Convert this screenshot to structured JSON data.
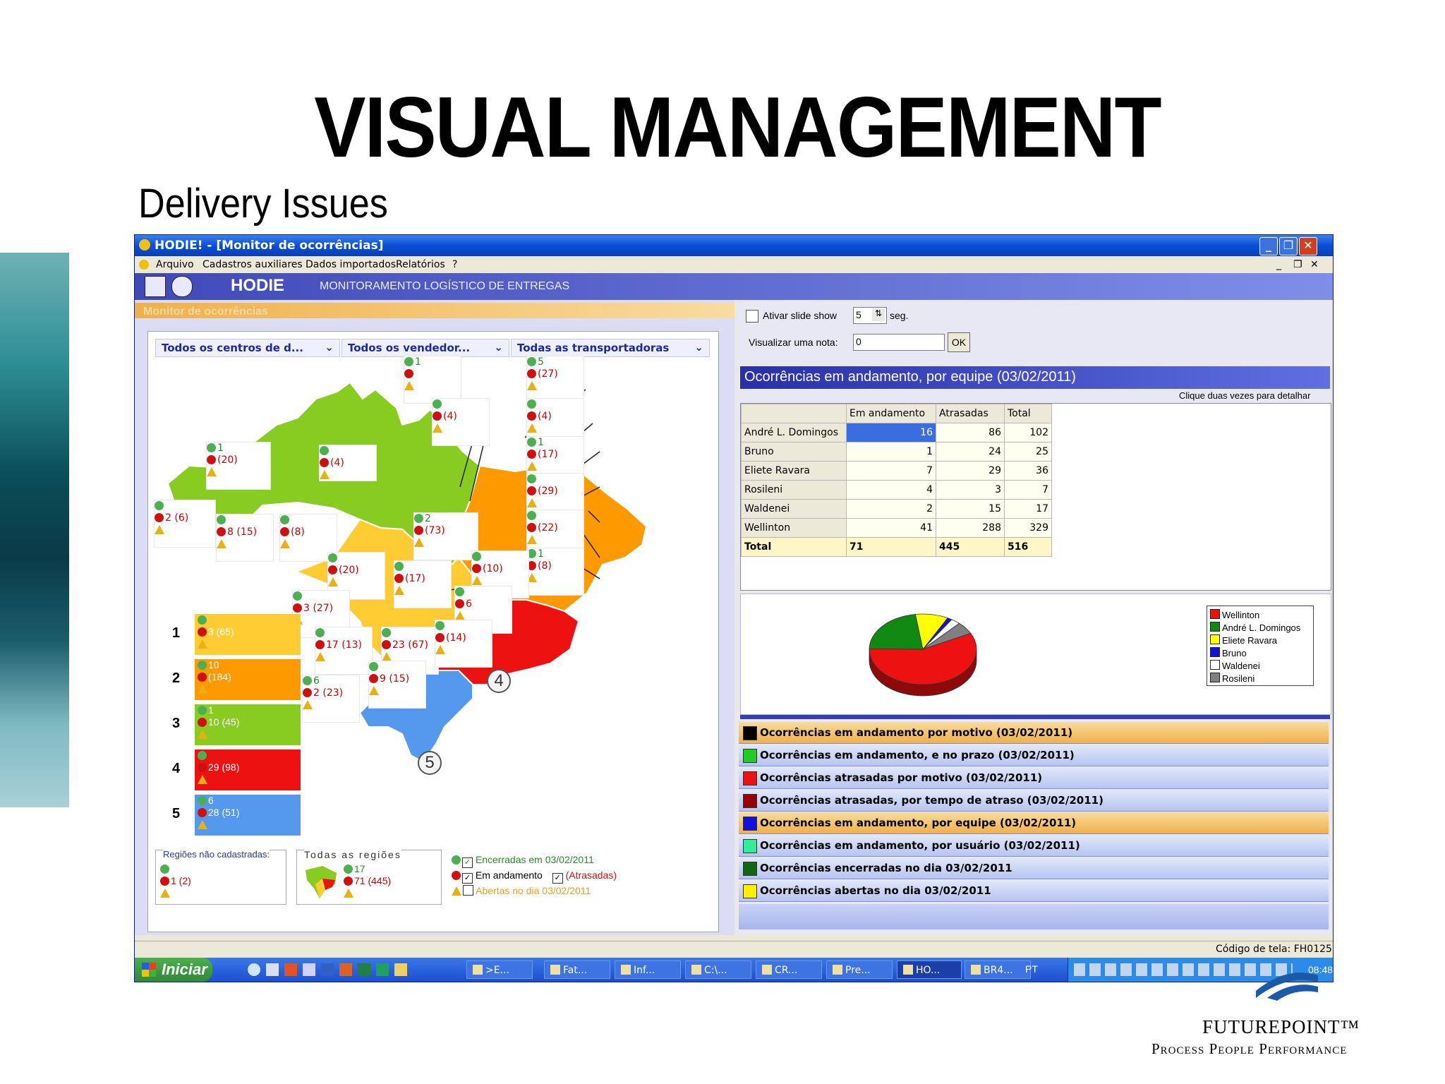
{
  "slide": {
    "title": "VISUAL MANAGEMENT",
    "subtitle": "Delivery Issues",
    "company": "FUTUREPOINT™",
    "tagline": "Process People Performance"
  },
  "window": {
    "title": "HODIE! - [Monitor de ocorrências]",
    "menu": [
      "Arquivo",
      "Cadastros auxiliares",
      "Dados importados",
      "Relatórios",
      "?"
    ],
    "banner_logo": "HODIE",
    "banner_text": "MONITORAMENTO LOGÍSTICO DE ENTREGAS",
    "panel_label": "Monitor de ocorrências"
  },
  "filters": {
    "centers": "Todos os centros de d...",
    "sellers": "Todos os vendedor...",
    "carriers": "Todas as transportadoras"
  },
  "map_boxes": [
    {
      "g": "1",
      "r": "(20)",
      "y": ""
    },
    {
      "g": "",
      "r": "(4)",
      "y": ""
    },
    {
      "g": "",
      "r": "2 (6)",
      "y": ""
    },
    {
      "g": "",
      "r": "8 (15)",
      "y": ""
    },
    {
      "g": "",
      "r": "(8)",
      "y": ""
    },
    {
      "g": "1",
      "r": "",
      "y": ""
    },
    {
      "g": "",
      "r": "(4)",
      "y": ""
    },
    {
      "g": "5",
      "r": "(27)",
      "y": ""
    },
    {
      "g": "",
      "r": "(4)",
      "y": ""
    },
    {
      "g": "1",
      "r": "(17)",
      "y": ""
    },
    {
      "g": "",
      "r": "(29)",
      "y": ""
    },
    {
      "g": "",
      "r": "(22)",
      "y": ""
    },
    {
      "g": "1",
      "r": "(8)",
      "y": ""
    },
    {
      "g": "2",
      "r": "(73)",
      "y": ""
    },
    {
      "g": "",
      "r": "(10)",
      "y": ""
    },
    {
      "g": "",
      "r": "(20)",
      "y": ""
    },
    {
      "g": "",
      "r": "(17)",
      "y": ""
    },
    {
      "g": "",
      "r": "3 (27)",
      "y": ""
    },
    {
      "g": "",
      "r": "6",
      "y": ""
    },
    {
      "g": "",
      "r": "17 (13)",
      "y": ""
    },
    {
      "g": "",
      "r": "23 (67)",
      "y": ""
    },
    {
      "g": "",
      "r": "(14)",
      "y": ""
    },
    {
      "g": "6",
      "r": "2 (23)",
      "y": ""
    },
    {
      "g": "",
      "r": "9 (15)",
      "y": ""
    }
  ],
  "region_markers": [
    "1",
    "2",
    "3",
    "4",
    "5"
  ],
  "regions_legend": [
    {
      "num": "1",
      "g": "",
      "r": "3 (65)",
      "color": "#ffcc33"
    },
    {
      "num": "2",
      "g": "10",
      "r": "(184)",
      "color": "#ff9900"
    },
    {
      "num": "3",
      "g": "1",
      "r": "10 (45)",
      "color": "#88cc22"
    },
    {
      "num": "4",
      "g": "",
      "r": "29 (98)",
      "color": "#ee1111"
    },
    {
      "num": "5",
      "g": "6",
      "r": "28 (51)",
      "color": "#5599ee"
    }
  ],
  "unregistered": {
    "label": "Regiões não cadastradas:",
    "r": "1 (2)"
  },
  "all_regions": {
    "label": "Todas as regiões",
    "g": "17",
    "r": "71 (445)"
  },
  "status_legend": {
    "closed": "Encerradas em 03/02/2011",
    "in_progress": "Em andamento",
    "late": "(Atrasadas)",
    "opened": "Abertas no dia 03/02/2011"
  },
  "controls": {
    "slideshow_label": "Ativar slide show",
    "slideshow_value": "5",
    "slideshow_unit": "seg.",
    "note_label": "Visualizar uma nota:",
    "note_value": "0",
    "ok": "OK"
  },
  "team_table": {
    "title": "Ocorrências em andamento, por equipe (03/02/2011)",
    "hint": "Clique duas vezes para detalhar",
    "headers": [
      "",
      "Em andamento",
      "Atrasadas",
      "Total"
    ],
    "rows": [
      [
        "André L. Domingos",
        "16",
        "86",
        "102"
      ],
      [
        "Bruno",
        "1",
        "24",
        "25"
      ],
      [
        "Eliete Ravara",
        "7",
        "29",
        "36"
      ],
      [
        "Rosileni",
        "4",
        "3",
        "7"
      ],
      [
        "Waldenei",
        "2",
        "15",
        "17"
      ],
      [
        "Wellinton",
        "41",
        "288",
        "329"
      ]
    ],
    "total": [
      "Total",
      "71",
      "445",
      "516"
    ]
  },
  "chart_data": {
    "type": "pie",
    "categories": [
      "Wellinton",
      "André L. Domingos",
      "Eliete Ravara",
      "Bruno",
      "Waldenei",
      "Rosileni"
    ],
    "values": [
      41,
      16,
      7,
      1,
      2,
      4
    ],
    "colors": [
      "#ee1111",
      "#118811",
      "#ffff00",
      "#1111dd",
      "#ffffff",
      "#808080"
    ],
    "legend": "right"
  },
  "categories": [
    {
      "label": "Ocorrências em andamento por motivo (03/02/2011)",
      "color": "#000000",
      "selected": true
    },
    {
      "label": "Ocorrências em andamento, e no prazo (03/02/2011)",
      "color": "#22cc22",
      "selected": false
    },
    {
      "label": "Ocorrências atrasadas por motivo (03/02/2011)",
      "color": "#ee1111",
      "selected": false
    },
    {
      "label": "Ocorrências atrasadas, por tempo de atraso (03/02/2011)",
      "color": "#990000",
      "selected": false
    },
    {
      "label": "Ocorrências em andamento, por equipe (03/02/2011)",
      "color": "#1111dd",
      "selected": true
    },
    {
      "label": "Ocorrências em andamento, por usuário (03/02/2011)",
      "color": "#33ee99",
      "selected": false
    },
    {
      "label": "Ocorrências encerradas no dia 03/02/2011",
      "color": "#116611",
      "selected": false
    },
    {
      "label": "Ocorrências abertas no dia 03/02/2011",
      "color": "#ffee00",
      "selected": false
    }
  ],
  "status": {
    "screen_code": "Código de tela: FH0125"
  },
  "taskbar": {
    "start": "Iniciar",
    "tasks": [
      ">E...",
      "Fat...",
      "Inf...",
      "C:\\...",
      "CR...",
      "Pre...",
      "HO...",
      "BR4..."
    ],
    "lang": "PT",
    "clock": "08:48"
  }
}
